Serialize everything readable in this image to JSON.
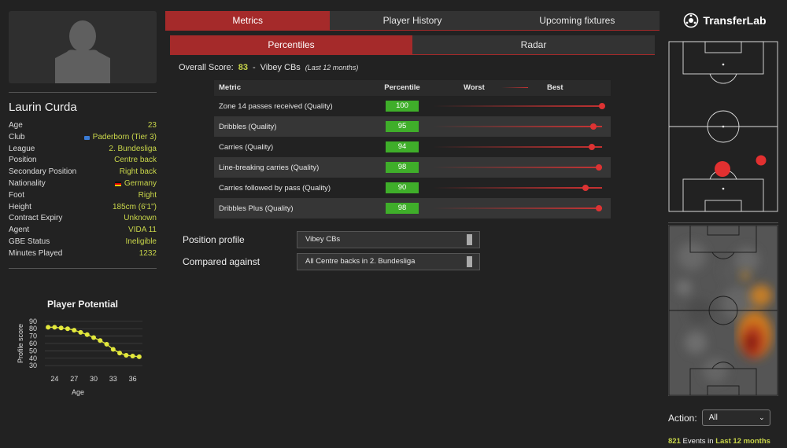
{
  "player": {
    "name": "Laurin Curda",
    "info": [
      {
        "key": "Age",
        "value": "23"
      },
      {
        "key": "Club",
        "value": "Paderborn (Tier 3)"
      },
      {
        "key": "League",
        "value": "2. Bundesliga"
      },
      {
        "key": "Position",
        "value": "Centre back"
      },
      {
        "key": "Secondary Position",
        "value": "Right back"
      },
      {
        "key": "Nationality",
        "value": "Germany"
      },
      {
        "key": "Foot",
        "value": "Right"
      },
      {
        "key": "Height",
        "value": "185cm (6'1\")"
      },
      {
        "key": "Contract Expiry",
        "value": "Unknown"
      },
      {
        "key": "Agent",
        "value": "VIDA 11"
      },
      {
        "key": "GBE Status",
        "value": "Ineligible"
      },
      {
        "key": "Minutes Played",
        "value": "1232"
      }
    ]
  },
  "tabs": [
    "Metrics",
    "Player History",
    "Upcoming fixtures"
  ],
  "subtabs": [
    "Percentiles",
    "Radar"
  ],
  "overall": {
    "label": "Overall Score:",
    "score": "83",
    "separator": "-",
    "profile": "Vibey CBs",
    "period": "(Last 12 months)"
  },
  "metrics_table": {
    "headers": {
      "metric": "Metric",
      "percentile": "Percentile",
      "worst": "Worst",
      "best": "Best"
    },
    "rows": [
      {
        "metric": "Zone 14 passes received (Quality)",
        "percentile": 100
      },
      {
        "metric": "Dribbles (Quality)",
        "percentile": 95
      },
      {
        "metric": "Carries (Quality)",
        "percentile": 94
      },
      {
        "metric": "Line-breaking carries (Quality)",
        "percentile": 98
      },
      {
        "metric": "Carries followed by pass (Quality)",
        "percentile": 90
      },
      {
        "metric": "Dribbles Plus (Quality)",
        "percentile": 98
      }
    ]
  },
  "controls": {
    "position_profile_label": "Position profile",
    "position_profile_value": "Vibey CBs",
    "compared_against_label": "Compared against",
    "compared_against_value": "All Centre backs in 2. Bundesliga"
  },
  "brand": {
    "name": "TransferLab"
  },
  "action": {
    "label": "Action:",
    "value": "All"
  },
  "events": {
    "count": "821",
    "text": "Events in",
    "period": "Last 12 months"
  },
  "colors": {
    "accent": "#a52a2a",
    "highlight": "#c9d64a",
    "badge": "#3fae2a",
    "dot": "#d33333"
  },
  "chart_data": {
    "type": "line",
    "title": "Player Potential",
    "xlabel": "Age",
    "ylabel": "Profile score",
    "x": [
      23,
      24,
      25,
      26,
      27,
      28,
      29,
      30,
      31,
      32,
      33,
      34,
      35,
      36,
      37
    ],
    "values": [
      82,
      82,
      81,
      80,
      78,
      75,
      72,
      68,
      64,
      59,
      52,
      47,
      44,
      43,
      42
    ],
    "xticks": [
      24,
      27,
      30,
      33,
      36
    ],
    "yticks": [
      30,
      40,
      50,
      60,
      70,
      80,
      90
    ],
    "xlim": [
      22.5,
      37.5
    ],
    "ylim": [
      27,
      93
    ],
    "grid": true
  }
}
